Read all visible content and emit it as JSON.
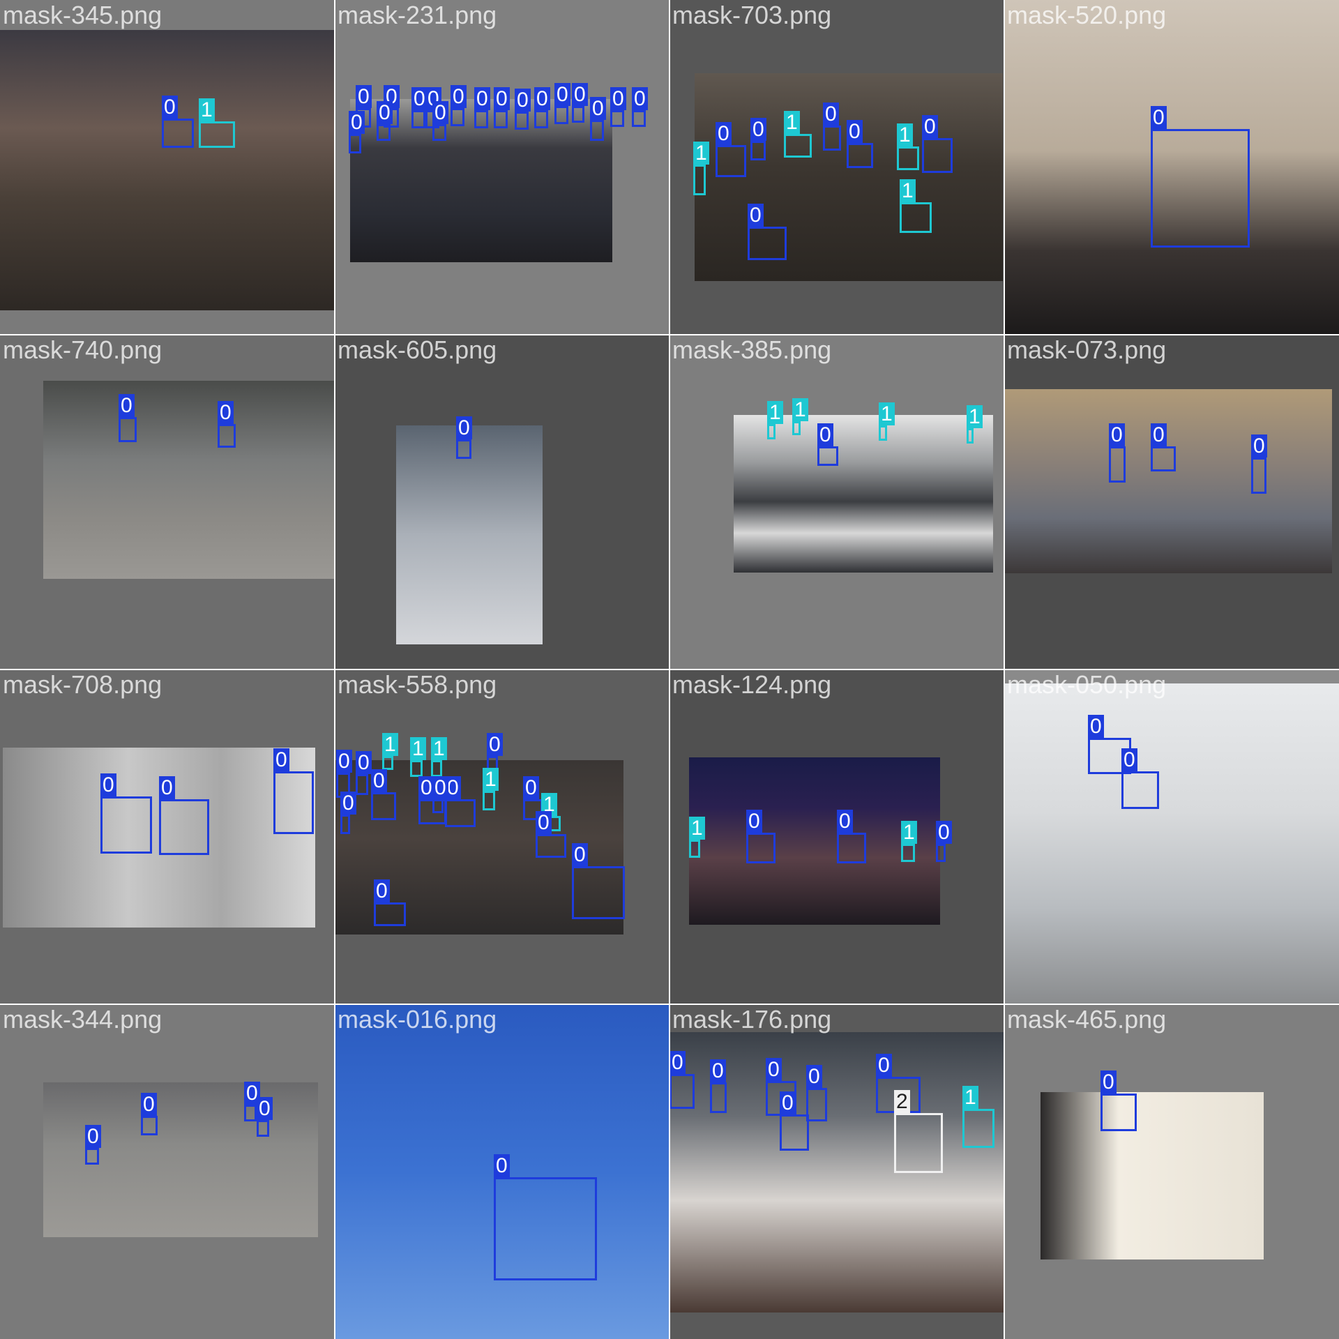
{
  "colors": {
    "0": "#1e3cdc",
    "1": "#1ec8d2",
    "2": "#f0f0f0"
  },
  "tiles": [
    {
      "name": "mask-345.png",
      "bg": "#7a7a7a",
      "photo_bg": "linear-gradient(180deg,#3c3a42 0%,#6b5a52 35%,#4a4038 60%,#2d2824 100%)",
      "labels": [
        "0",
        "1"
      ]
    },
    {
      "name": "mask-231.png",
      "bg": "#808080",
      "photo_bg": "linear-gradient(180deg,#9a9a98 0%,#3a3a40 30%,#2a2c34 70%,#1e1e22 100%)",
      "labels": [
        "0",
        "0",
        "0",
        "0",
        "0",
        "0",
        "0",
        "0",
        "0",
        "0",
        "0",
        "0",
        "0",
        "0",
        "0",
        "0",
        "0"
      ]
    },
    {
      "name": "mask-703.png",
      "bg": "#575757",
      "photo_bg": "linear-gradient(180deg,#605850 0%,#3c3630 45%,#2a2622 100%)",
      "labels": [
        "1",
        "0",
        "0",
        "1",
        "0",
        "0",
        "1",
        "0",
        "1",
        "0"
      ]
    },
    {
      "name": "mask-520.png",
      "bg": "#585858",
      "photo_bg": "linear-gradient(180deg,#cfc5b8 0%,#b8ab9a 45%,#3a3432 75%,#1c1a1a 100%)",
      "labels": [
        "0"
      ]
    },
    {
      "name": "mask-740.png",
      "bg": "#6d6d6d",
      "photo_bg": "linear-gradient(180deg,#4a4c4a 0%,#7a7c7c 40%,#8c8a86 70%,#9a9894 100%)",
      "labels": [
        "0",
        "0"
      ]
    },
    {
      "name": "mask-605.png",
      "bg": "#4f4f4f",
      "photo_bg": "linear-gradient(180deg,#5a6470 0%,#aab0b8 50%,#d4d6da 100%)",
      "labels": [
        "0"
      ]
    },
    {
      "name": "mask-385.png",
      "bg": "#7e7e7e",
      "photo_bg": "linear-gradient(180deg,#e4e4e4 0%,#9a9c9e 30%,#3c3e42 55%,#d8d8d8 75%,#2e3034 100%)",
      "labels": [
        "1",
        "1",
        "1",
        "0",
        "1"
      ]
    },
    {
      "name": "mask-073.png",
      "bg": "#4c4c4c",
      "photo_bg": "linear-gradient(180deg,#b09a78 0%,#8a8078 40%,#6a6e78 70%,#3c3838 100%)",
      "labels": [
        "0",
        "0",
        "0"
      ]
    },
    {
      "name": "mask-708.png",
      "bg": "#6a6a6a",
      "photo_bg": "linear-gradient(90deg,#8a8a8a 0%,#c8c8c8 40%,#a8a8a8 70%,#d8d8d8 100%)",
      "labels": [
        "0",
        "0",
        "0"
      ]
    },
    {
      "name": "mask-558.png",
      "bg": "#5e5e5e",
      "photo_bg": "linear-gradient(180deg,#3a3634 0%,#4a423e 45%,#2c2a2a 100%)",
      "labels": [
        "1",
        "1",
        "1",
        "0",
        "0",
        "0",
        "0",
        "0",
        "0",
        "1",
        "0",
        "0",
        "1",
        "0",
        "0",
        "0",
        "0"
      ]
    },
    {
      "name": "mask-124.png",
      "bg": "#505050",
      "photo_bg": "linear-gradient(180deg,#1a1c48 0%,#2a2050 30%,#5a4048 60%,#1e1a20 100%)",
      "labels": [
        "1",
        "0",
        "0",
        "1",
        "0"
      ]
    },
    {
      "name": "mask-050.png",
      "bg": "#8a8a8a",
      "photo_bg": "linear-gradient(180deg,#e8eaec 0%,#d8dadc 40%,#b8bcc0 70%,#8a8c8e 100%)",
      "labels": [
        "0",
        "0"
      ]
    },
    {
      "name": "mask-344.png",
      "bg": "#7a7a7a",
      "photo_bg": "linear-gradient(180deg,#6a6a6c 0%,#8a8a88 40%,#9c9a96 100%)",
      "labels": [
        "0",
        "0",
        "0",
        "0"
      ]
    },
    {
      "name": "mask-016.png",
      "bg": "#3c5aa0",
      "photo_bg": "linear-gradient(180deg,#2a5ac0 0%,#3c72d2 50%,#6a9ae0 100%)",
      "labels": [
        "0"
      ]
    },
    {
      "name": "mask-176.png",
      "bg": "#5a5a5a",
      "photo_bg": "linear-gradient(180deg,#3a4048 0%,#6a6e74 30%,#d8d4d0 60%,#4a3a34 100%)",
      "labels": [
        "0",
        "0",
        "0",
        "0",
        "0",
        "0",
        "2",
        "1"
      ]
    },
    {
      "name": "mask-465.png",
      "bg": "#7f7f7f",
      "photo_bg": "linear-gradient(90deg,#2a2828 0%,#f2ede2 35%,#e8e2d6 100%)",
      "labels": [
        "0"
      ]
    }
  ]
}
